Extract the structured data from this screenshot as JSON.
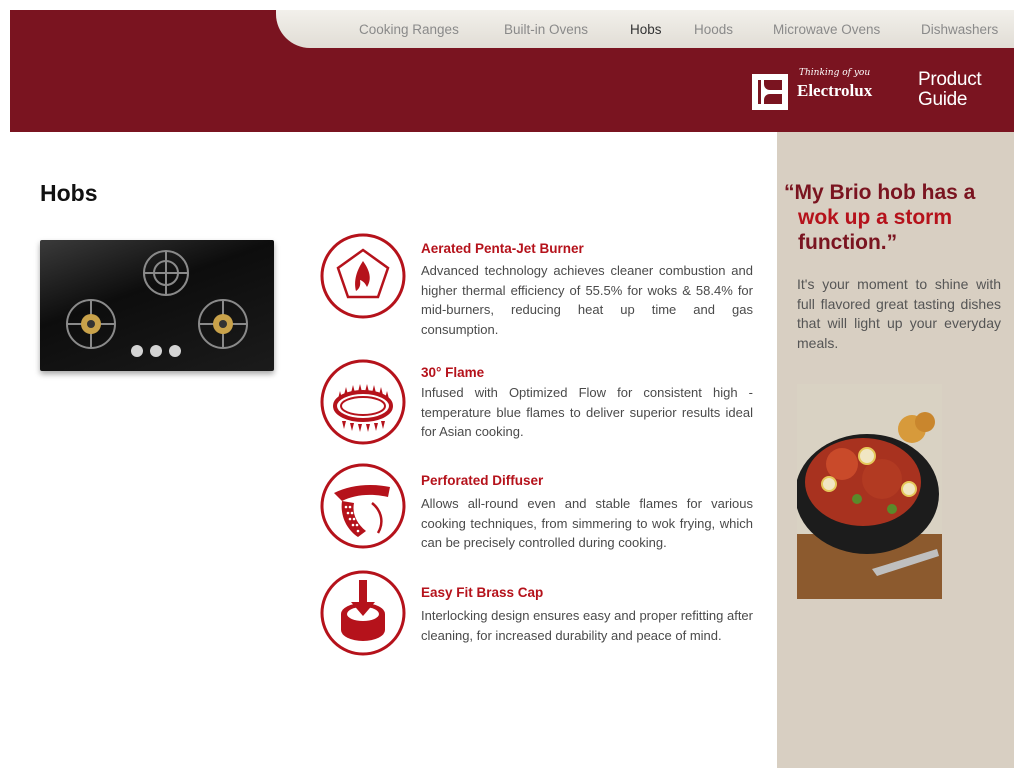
{
  "nav": {
    "items": [
      {
        "label": "Cooking Ranges"
      },
      {
        "label": "Built-in Ovens"
      },
      {
        "label": "Hobs",
        "active": true
      },
      {
        "label": "Hoods"
      },
      {
        "label": "Microwave Ovens"
      },
      {
        "label": "Dishwashers"
      }
    ]
  },
  "brand": {
    "tagline": "Thinking of you",
    "name": "Electrolux",
    "guide_title": "Product Guide",
    "logo_icon": "electrolux-logo"
  },
  "page": {
    "title": "Hobs"
  },
  "features": [
    {
      "icon": "burner-flame-icon",
      "title": "Aerated Penta-Jet Burner",
      "desc": "Advanced technology achieves cleaner combustion and higher thermal efficiency of 55.5% for woks & 58.4% for mid-burners, reducing heat up time and gas consumption."
    },
    {
      "icon": "flame-ring-icon",
      "title": "30° Flame",
      "desc": "Infused with Optimized Flow for consistent high -temperature blue flames to deliver superior results ideal for Asian cooking."
    },
    {
      "icon": "diffuser-icon",
      "title": "Perforated Diffuser",
      "desc": "Allows all-round even and stable flames for various cooking techniques, from simmering to wok frying, which can be precisely controlled during cooking."
    },
    {
      "icon": "brass-cap-icon",
      "title": "Easy Fit Brass Cap",
      "desc": "Interlocking design ensures easy and proper refitting after cleaning, for increased durability and peace of mind."
    }
  ],
  "sidebar": {
    "quote_line1": "“My Brio hob has a",
    "quote_line2": "wok up a storm",
    "quote_line3": "function.”",
    "text": "It's your moment to shine with full flavored great tasting dishes that will light up your everyday meals."
  },
  "colors": {
    "header_bg": "#7a1420",
    "accent_red": "#b5121b",
    "sidebar_bg": "#d8cfc2",
    "nav_bg": "#e8e5df"
  }
}
